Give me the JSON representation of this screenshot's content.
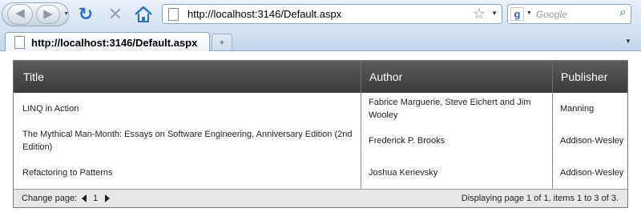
{
  "browser": {
    "address": "http://localhost:3146/Default.aspx",
    "search_placeholder": "Google",
    "search_engine_icon": "google-g-icon",
    "tab_title": "http://localhost:3146/Default.aspx",
    "icons": {
      "back": "back-arrow-icon",
      "forward": "forward-arrow-icon",
      "reload": "reload-icon",
      "stop": "stop-icon",
      "home": "home-icon",
      "bookmark": "star-icon",
      "search": "magnifier-icon",
      "new_tab": "new-tab-icon"
    },
    "glyphs": {
      "back": "◀",
      "forward": "▶",
      "history_dd": "▼",
      "reload": "↻",
      "stop": "✕",
      "star": "☆",
      "dropdown": "▼",
      "google": "g",
      "search": "⌕",
      "new_tab": "+",
      "tab_menu": "▼"
    },
    "accent_color": "#2a6fc9"
  },
  "grid": {
    "columns": [
      "Title",
      "Author",
      "Publisher"
    ],
    "rows": [
      {
        "title": "LINQ in Action",
        "author": "Fabrice Marguerie, Steve Eichert and Jim Wooley",
        "publisher": "Manning"
      },
      {
        "title": "The Mythical Man-Month: Essays on Software Engineering, Anniversary Edition (2nd Edition)",
        "author": "Frederick P. Brooks",
        "publisher": "Addison-Wesley"
      },
      {
        "title": "Refactoring to Patterns",
        "author": "Joshua Kerievsky",
        "publisher": "Addison-Wesley"
      }
    ],
    "header_color": "#4a4a4a",
    "pager": {
      "change_label": "Change page:",
      "current_page": "1",
      "info": "Displaying page 1 of 1, items 1 to 3 of 3."
    }
  }
}
